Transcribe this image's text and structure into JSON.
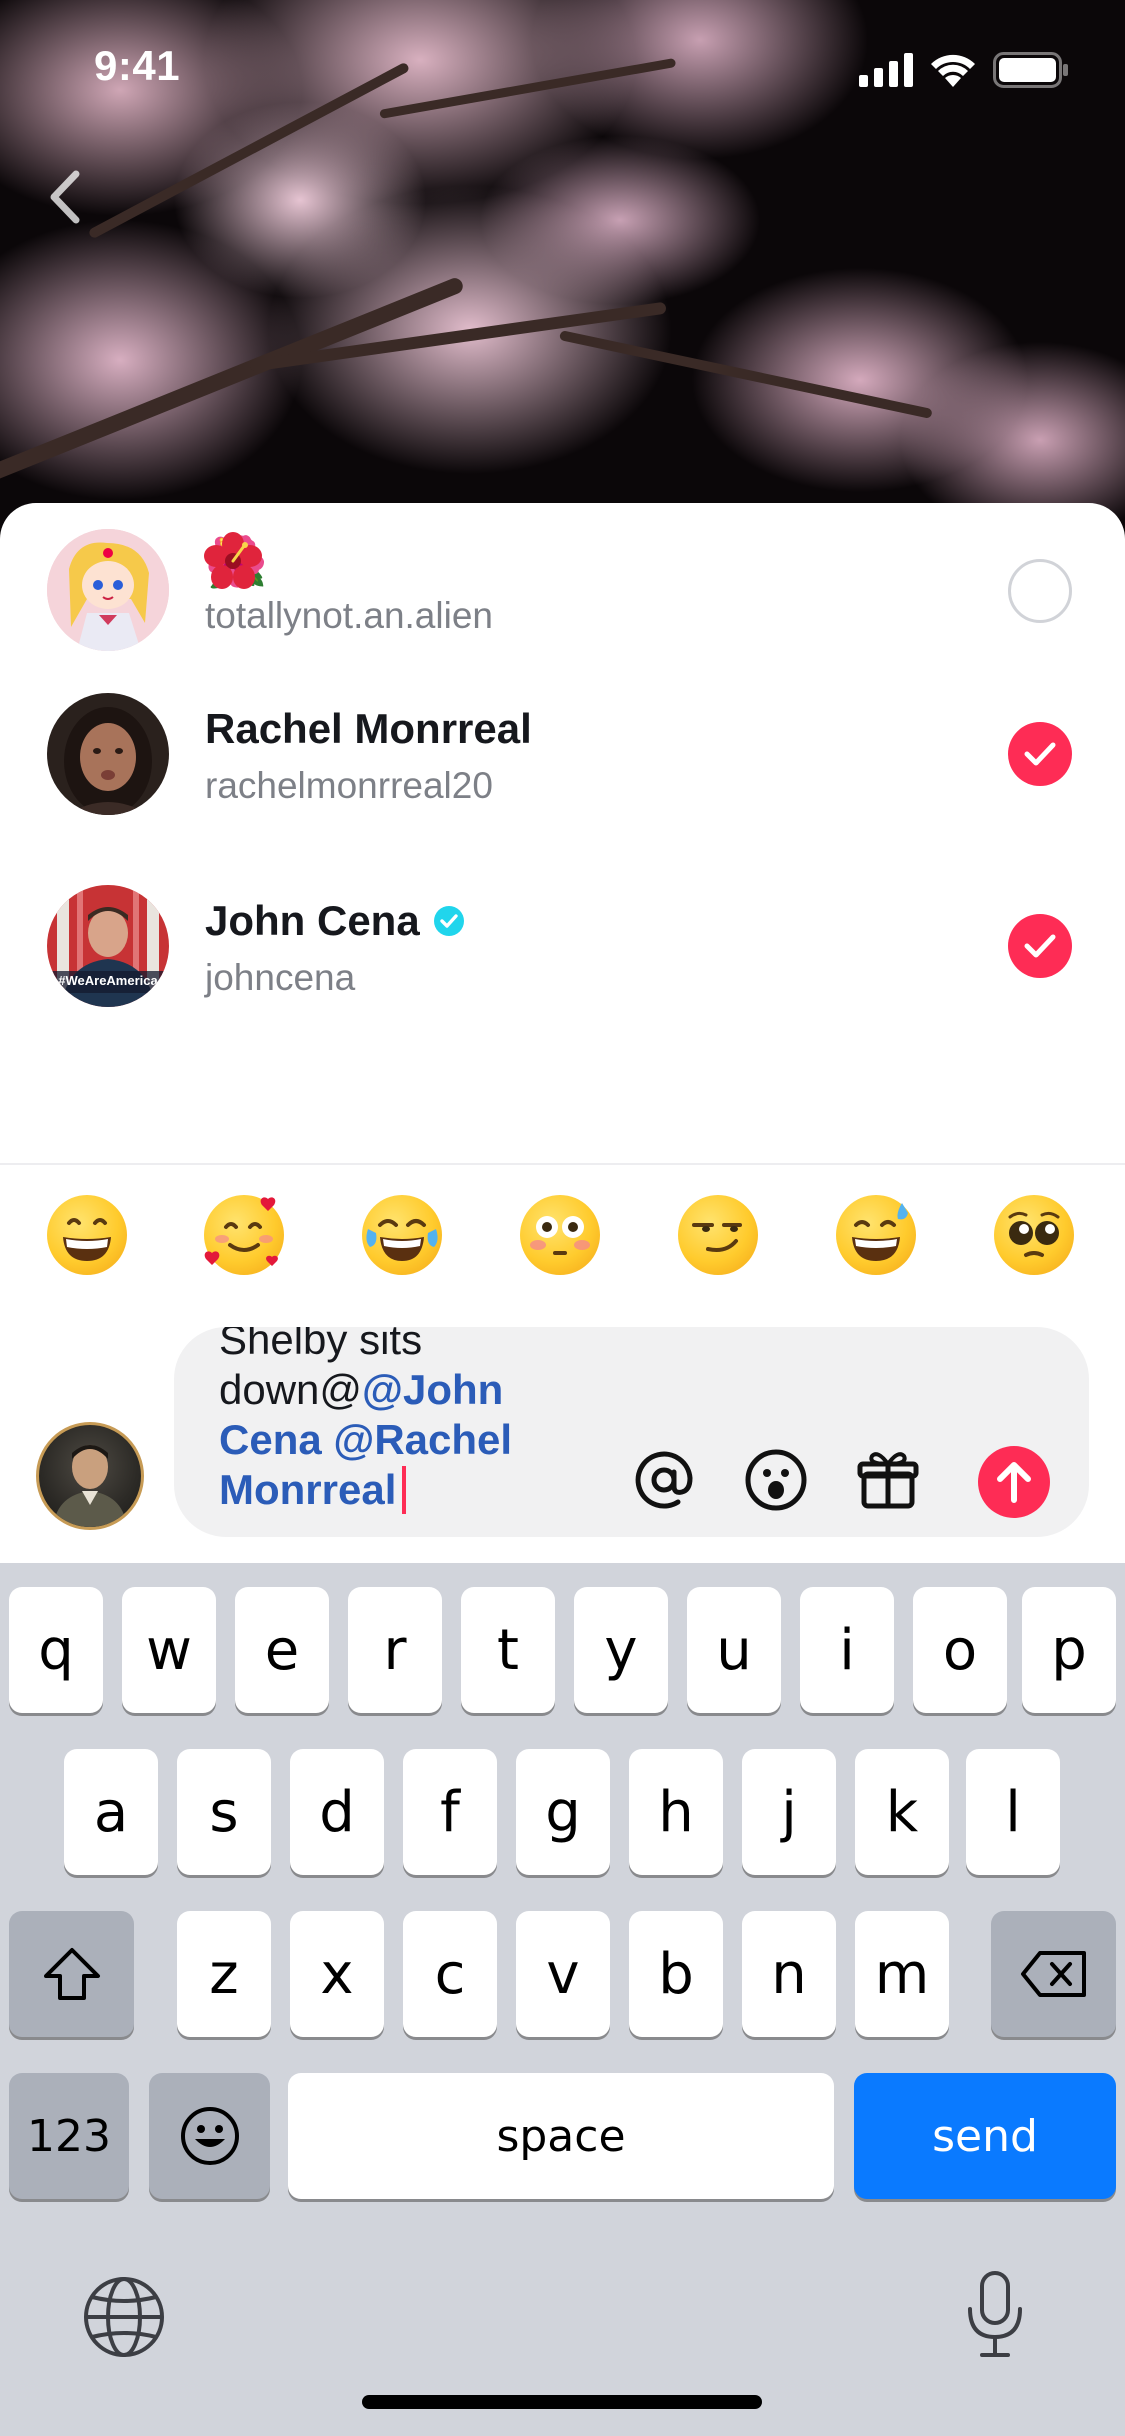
{
  "status_bar": {
    "time": "9:41"
  },
  "users": [
    {
      "emoji_name": "🌺",
      "name": "",
      "handle": "totallynot.an.alien",
      "verified": false,
      "selected": false
    },
    {
      "emoji_name": "",
      "name": "Rachel Monrreal",
      "handle": "rachelmonrreal20",
      "verified": false,
      "selected": true
    },
    {
      "emoji_name": "",
      "name": "John Cena",
      "handle": "johncena",
      "verified": true,
      "selected": true
    }
  ],
  "avatar_caption": "#WeAreAmerica",
  "quick_emojis": [
    "grinning",
    "smiling-hearts",
    "tears-of-joy",
    "flushed",
    "smirking",
    "sweat-smile",
    "pleading"
  ],
  "composer": {
    "text_partial": "Shelby sits",
    "text_line2": "down@",
    "mention_1": "@John",
    "mention_1b": "Cena",
    "mention_2": "@Rachel",
    "mention_2b": "Monrreal"
  },
  "keyboard": {
    "row1": [
      "q",
      "w",
      "e",
      "r",
      "t",
      "y",
      "u",
      "i",
      "o",
      "p"
    ],
    "row2": [
      "a",
      "s",
      "d",
      "f",
      "g",
      "h",
      "j",
      "k",
      "l"
    ],
    "row3": [
      "z",
      "x",
      "c",
      "v",
      "b",
      "n",
      "m"
    ],
    "numbers_label": "123",
    "space_label": "space",
    "send_label": "send"
  },
  "colors": {
    "accent": "#fe2c55",
    "mention": "#2b5cb8",
    "keyboard_send": "#0a7aff",
    "verified": "#20d5ec"
  }
}
